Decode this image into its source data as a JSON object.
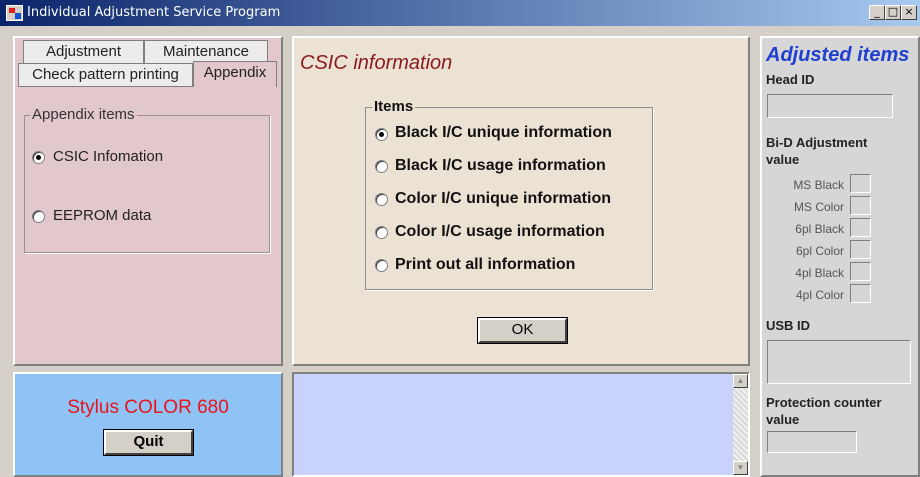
{
  "window": {
    "title": "Individual Adjustment Service Program",
    "buttons": [
      "_",
      "□",
      "×"
    ]
  },
  "tabs": {
    "row1": [
      "Adjustment",
      "Maintenance"
    ],
    "row2": [
      "Check pattern printing",
      "Appendix"
    ]
  },
  "appendix": {
    "group_caption": "Appendix items",
    "options": [
      {
        "label": "CSIC Infomation",
        "selected": true
      },
      {
        "label": "EEPROM data",
        "selected": false
      }
    ]
  },
  "center": {
    "title": "CSIC information",
    "group_caption": "Items",
    "options": [
      {
        "label": "Black I/C unique information",
        "selected": true
      },
      {
        "label": "Black I/C usage information",
        "selected": false
      },
      {
        "label": "Color I/C unique information",
        "selected": false
      },
      {
        "label": "Color I/C usage information",
        "selected": false
      },
      {
        "label": "Print out all information",
        "selected": false
      }
    ],
    "ok_label": "OK"
  },
  "model": {
    "name": "Stylus COLOR 680",
    "quit_label": "Quit"
  },
  "right": {
    "title": "Adjusted items",
    "head_id_label": "Head ID",
    "bid_label": "Bi-D Adjustment value",
    "bid_rows": [
      "MS Black",
      "MS Color",
      "6pl Black",
      "6pl Color",
      "4pl Black",
      "4pl Color"
    ],
    "usb_label": "USB ID",
    "protection_label": "Protection counter value"
  },
  "colors": {
    "title_title": "#8b1a1a",
    "model_name": "#e8141a",
    "right_title": "#1f3fd0"
  }
}
